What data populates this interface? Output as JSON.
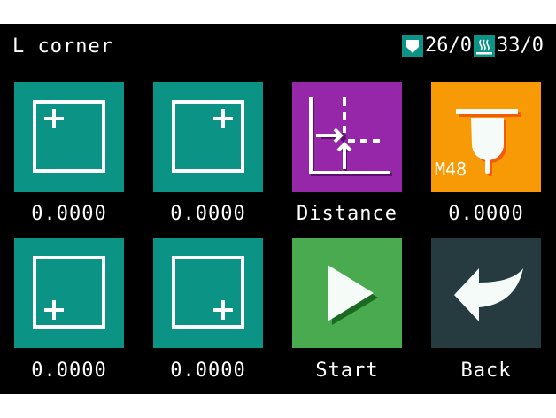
{
  "header": {
    "title": "L corner"
  },
  "status": {
    "nozzle": {
      "icon": "nozzle-temp-icon",
      "value": "26/0"
    },
    "bed": {
      "icon": "bed-temp-icon",
      "value": "33/0"
    }
  },
  "tiles": [
    {
      "icon": "top-left-corner-icon",
      "label": "0.0000",
      "color": "#0b9486"
    },
    {
      "icon": "top-right-corner-icon",
      "label": "0.0000",
      "color": "#0b9486"
    },
    {
      "icon": "distance-icon",
      "label": "Distance",
      "color": "#9627a8"
    },
    {
      "icon": "probe-icon",
      "label": "0.0000",
      "badge": "M48",
      "color": "#f79a05"
    },
    {
      "icon": "bottom-left-corner-icon",
      "label": "0.0000",
      "color": "#0b9486"
    },
    {
      "icon": "bottom-right-corner-icon",
      "label": "0.0000",
      "color": "#0b9486"
    },
    {
      "icon": "play-icon",
      "label": "Start",
      "color": "#4aaa50"
    },
    {
      "icon": "back-arrow-icon",
      "label": "Back",
      "color": "#263b3f"
    }
  ]
}
